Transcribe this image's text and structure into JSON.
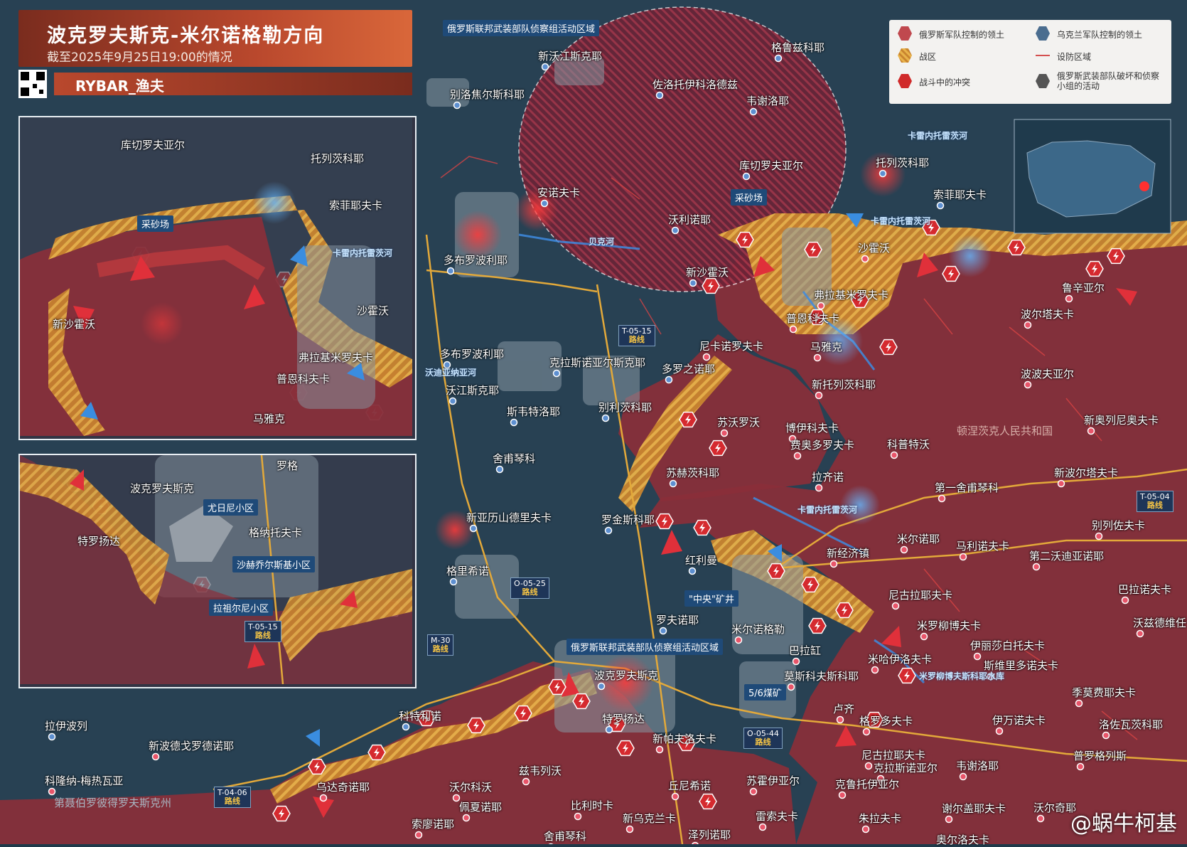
{
  "header": {
    "title": "波克罗夫斯克-米尔诺格勒方向",
    "subtitle": "截至2025年9月25日19:00的情况",
    "brand": "RYBAR_渔夫"
  },
  "legend": {
    "items": [
      {
        "label": "俄罗斯军队控制的领土",
        "color": "#c0484e"
      },
      {
        "label": "乌克兰军队控制的领土",
        "color": "#4a6d8f"
      },
      {
        "label": "战区",
        "color": "#e5a040"
      },
      {
        "label": "设防区域",
        "color": "#d45050"
      },
      {
        "label": "战斗中的冲突",
        "color": "#d02a2a"
      },
      {
        "label": "俄罗斯武装部队破坏和侦察小组的活动",
        "color": "#555555"
      }
    ]
  },
  "map_labels": {
    "recon_north": "俄罗斯联邦武装部队侦察组活动区域",
    "recon_south": "俄罗斯联邦武装部队侦察组活动区域",
    "quarry_main": "采砂场",
    "quarry_inset": "采砂场",
    "shaft": "\"中央\"矿井",
    "coal_mine": "5/6煤矿",
    "dnr": "顿涅茨克人民共和国",
    "dnipro_oblast": "第聂伯罗彼得罗夫斯克州"
  },
  "rivers": [
    "卡雷内托雷茨河",
    "卡雷内托雷茨河",
    "卡雷内托雷茨河",
    "卡雷内托雷茨河",
    "贝克河",
    "沃迪亚纳亚河",
    "米罗柳博夫斯科耶水库"
  ],
  "routes": [
    {
      "code": "T-05-15",
      "word": "路线"
    },
    {
      "code": "O-05-25",
      "word": "路线"
    },
    {
      "code": "M-30",
      "word": "路线"
    },
    {
      "code": "O-05-44",
      "word": "路线"
    },
    {
      "code": "T-04-06",
      "word": "路线"
    },
    {
      "code": "T-05-04",
      "word": "路线"
    },
    {
      "code": "T-05-15",
      "word": "路线"
    }
  ],
  "places": [
    "格鲁兹科耶",
    "新沃江斯克耶",
    "佐洛托伊科洛德兹",
    "韦谢洛耶",
    "别洛焦尔斯科耶",
    "库切罗夫亚尔",
    "托列茨科耶",
    "索菲耶夫卡",
    "安诺夫卡",
    "沃利诺耶",
    "多布罗波利耶",
    "新沙霍沃",
    "沙霍沃",
    "弗拉基米罗夫卡",
    "普恩科夫卡",
    "尼卡诺罗夫卡",
    "马雅克",
    "鲁辛亚尔",
    "波尔塔夫卡",
    "波波夫亚尔",
    "多布罗波利耶",
    "克拉斯诺亚尔斯克耶",
    "多罗之诺耶",
    "新托列茨科耶",
    "沃江斯克耶",
    "斯韦特洛耶",
    "别利茨科耶",
    "苏沃罗沃",
    "博伊科夫卡",
    "费奥多罗夫卡",
    "科普特沃",
    "新奥列尼奥夫卡",
    "舍甫琴科",
    "苏赫茨科耶",
    "拉齐诺",
    "第一舍甫琴科",
    "新波尔塔夫卡",
    "新亚历山德里夫卡",
    "罗金斯科耶",
    "红利曼",
    "别列佐夫卡",
    "米尔诺耶",
    "马利诺夫卡",
    "新经济镇",
    "第二沃迪亚诺耶",
    "格里希诺",
    "巴拉诺夫卡",
    "尼古拉耶夫卡",
    "罗夫诺耶",
    "米尔诺格勒",
    "米罗柳博夫卡",
    "沃兹德维任卡",
    "伊丽莎白托夫卡",
    "巴拉缸",
    "米哈伊洛夫卡",
    "斯维里多诺夫卡",
    "莫斯科夫斯科耶",
    "季莫费耶夫卡",
    "波克罗夫斯克",
    "科特利诺",
    "特罗扬达",
    "卢齐",
    "伊万诺夫卡",
    "格罗多夫卡",
    "洛佐瓦茨科耶",
    "拉伊波列",
    "新帕夫洛夫卡",
    "新波德戈罗德诺耶",
    "兹韦列沃",
    "尼古拉耶夫卡",
    "克拉斯诺亚尔",
    "韦谢洛耶",
    "普罗格列斯",
    "科隆纳-梅热瓦亚",
    "乌达奇诺耶",
    "沃尔科沃",
    "丘尼希诺",
    "苏霍伊亚尔",
    "克鲁托伊亚尔",
    "佩夏诺耶",
    "比利时卡",
    "谢尔盖耶夫卡",
    "沃尔奇耶",
    "索廖诺耶",
    "新乌克兰卡",
    "雷索夫卡",
    "朱拉夫卡",
    "舍甫琴科",
    "泽列诺耶",
    "奥尔洛夫卡"
  ],
  "inset1_places": [
    "库切罗夫亚尔",
    "托列茨科耶",
    "索菲耶夫卡",
    "沙霍沃",
    "新沙霍沃",
    "弗拉基米罗夫卡",
    "普恩科夫卡",
    "马雅克"
  ],
  "inset1_river": "卡雷内托雷茨河",
  "inset2_places": [
    "波克罗夫斯克",
    "特罗扬达",
    "格纳托夫卡",
    "罗格"
  ],
  "inset2_districts": [
    "尤日尼小区",
    "沙赫乔尔斯基小区",
    "拉祖尔尼小区"
  ],
  "watermark": "@蜗牛柯基"
}
